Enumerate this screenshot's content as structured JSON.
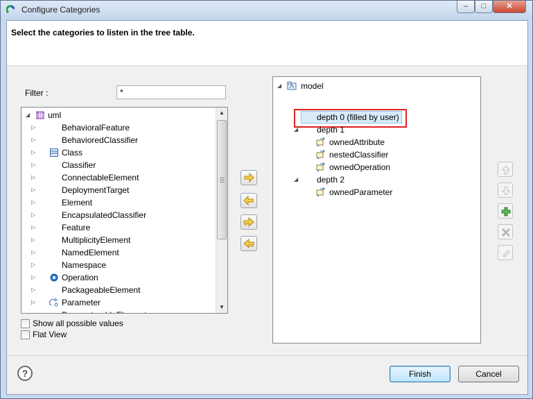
{
  "window": {
    "title": "Configure Categories",
    "controls": {
      "minimize": "–",
      "maximize": "□",
      "close": "✕"
    }
  },
  "header": {
    "message": "Select the categories to listen in the tree table."
  },
  "filter": {
    "label": "Filter :",
    "value": "*"
  },
  "left_tree": {
    "root": "uml",
    "items": [
      {
        "label": "BehavioralFeature",
        "icon": "none"
      },
      {
        "label": "BehavioredClassifier",
        "icon": "none"
      },
      {
        "label": "Class",
        "icon": "class-icon"
      },
      {
        "label": "Classifier",
        "icon": "none"
      },
      {
        "label": "ConnectableElement",
        "icon": "none"
      },
      {
        "label": "DeploymentTarget",
        "icon": "none"
      },
      {
        "label": "Element",
        "icon": "none"
      },
      {
        "label": "EncapsulatedClassifier",
        "icon": "none"
      },
      {
        "label": "Feature",
        "icon": "none"
      },
      {
        "label": "MultiplicityElement",
        "icon": "none"
      },
      {
        "label": "NamedElement",
        "icon": "none"
      },
      {
        "label": "Namespace",
        "icon": "none"
      },
      {
        "label": "Operation",
        "icon": "operation-icon"
      },
      {
        "label": "PackageableElement",
        "icon": "none"
      },
      {
        "label": "Parameter",
        "icon": "parameter-icon"
      },
      {
        "label": "ParameterableElement",
        "icon": "none"
      }
    ]
  },
  "options": {
    "show_all_label": "Show all possible values",
    "flat_view_label": "Flat View"
  },
  "transfer_buttons": [
    "arrow-right-icon",
    "arrow-left-icon",
    "double-arrow-right-icon",
    "double-arrow-left-icon"
  ],
  "right_tree": {
    "root": "model",
    "depth0": "depth 0 (filled by user)",
    "depth1": "depth 1",
    "depth1_items": [
      "ownedAttribute",
      "nestedClassifier",
      "ownedOperation"
    ],
    "depth2": "depth 2",
    "depth2_items": [
      "ownedParameter"
    ]
  },
  "side_buttons": [
    "move-up-icon",
    "move-down-icon",
    "add-icon",
    "delete-icon",
    "edit-icon"
  ],
  "footer": {
    "finish": "Finish",
    "cancel": "Cancel",
    "help": "?"
  },
  "colors": {
    "highlight": "#e02020",
    "accent": "#3c7fb1",
    "selection": "#d9ebf9"
  }
}
